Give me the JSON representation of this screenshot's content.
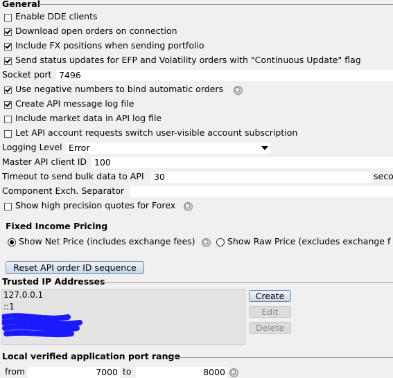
{
  "general": {
    "title": "General",
    "options": [
      {
        "label": "Enable DDE clients",
        "checked": false
      },
      {
        "label": "Download open orders on connection",
        "checked": true
      },
      {
        "label": "Include FX positions when sending portfolio",
        "checked": true
      },
      {
        "label": "Send status updates for EFP and Volatility orders with \"Continuous Update\" flag",
        "checked": true
      }
    ],
    "socket_port": {
      "label": "Socket port",
      "value": "7496"
    },
    "options2": [
      {
        "label": "Use negative numbers to bind automatic orders",
        "checked": true
      },
      {
        "label": "Create API message log file",
        "checked": true
      },
      {
        "label": "Include market data in API log file",
        "checked": false
      },
      {
        "label": "Let API account requests switch user-visible account subscription",
        "checked": false
      }
    ],
    "logging_level": {
      "label": "Logging Level",
      "value": "Error"
    },
    "master_client_id": {
      "label": "Master API client ID",
      "value": "100"
    },
    "timeout": {
      "label": "Timeout to send bulk data to API",
      "value": "30",
      "unit": "seco"
    },
    "component_separator": {
      "label": "Component Exch. Separator",
      "value": ""
    },
    "high_precision": {
      "label": "Show high precision quotes for Forex",
      "checked": false
    }
  },
  "fixed_income": {
    "title": "Fixed Income Pricing",
    "net_price": {
      "label": "Show Net Price (includes exchange fees)",
      "selected": true
    },
    "raw_price": {
      "label": "Show Raw Price (excludes exchange f",
      "selected": false
    }
  },
  "reset_button": "Reset API order ID sequence",
  "trusted_ip": {
    "title": "Trusted IP Addresses",
    "entries": [
      "127.0.0.1",
      "::1"
    ],
    "buttons": {
      "create": "Create",
      "edit": "Edit",
      "delete": "Delete"
    }
  },
  "port_range": {
    "title": "Local verified application port range",
    "from_label": "from",
    "from_value": "7000",
    "to_label": "to",
    "to_value": "8000"
  },
  "colors": {
    "redaction": "#1a1aff",
    "panel_bg": "#f0f0f0"
  }
}
